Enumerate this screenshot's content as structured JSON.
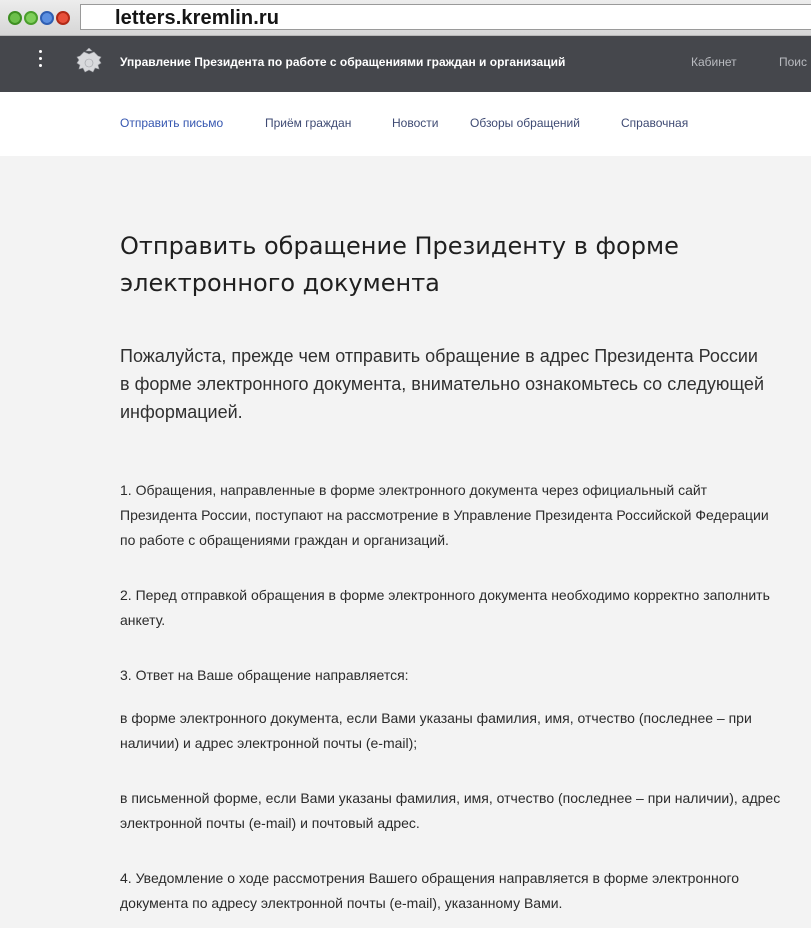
{
  "browser": {
    "url": "letters.kremlin.ru"
  },
  "header": {
    "title": "Управление Президента по работе с обращениями граждан и организаций",
    "links": [
      "Кабинет",
      "Поис"
    ]
  },
  "subnav": {
    "items": [
      "Отправить письмо",
      "Приём граждан",
      "Новости",
      "Обзоры обращений",
      "Справочная"
    ]
  },
  "main": {
    "title": "Отправить обращение Президенту в форме электронного документа",
    "lead": "Пожалуйста, прежде чем отправить обращение в адрес Президента России в форме электронного документа, внимательно ознакомьтесь со следующей информацией.",
    "paragraphs": [
      "1. Обращения, направленные в форме электронного документа через официальный сайт Президента России, поступают на рассмотрение в Управление Президента Российской Федерации по работе с обращениями граждан и организаций.",
      "2. Перед отправкой обращения в форме электронного документа необходимо корректно заполнить анкету.",
      "3. Ответ на Ваше обращение направляется:",
      "в форме электронного документа, если Вами указаны фамилия, имя, отчество (последнее – при наличии) и адрес электронной почты (e-mail);",
      "в письменной форме, если Вами указаны фамилия, имя, отчество (последнее – при наличии), адрес электронной почты (e-mail) и почтовый адрес.",
      "4. Уведомление о ходе рассмотрения Вашего обращения направляется в форме электронного документа по адресу электронной почты (e-mail), указанному Вами."
    ]
  },
  "colors": {
    "header_bg": "#45474c",
    "page_bg": "#f3f3f3",
    "nav_link": "#3e4a73",
    "nav_active": "#3556b0"
  },
  "icons": [
    "traffic-light-icon",
    "menu-icon",
    "emblem-icon"
  ]
}
